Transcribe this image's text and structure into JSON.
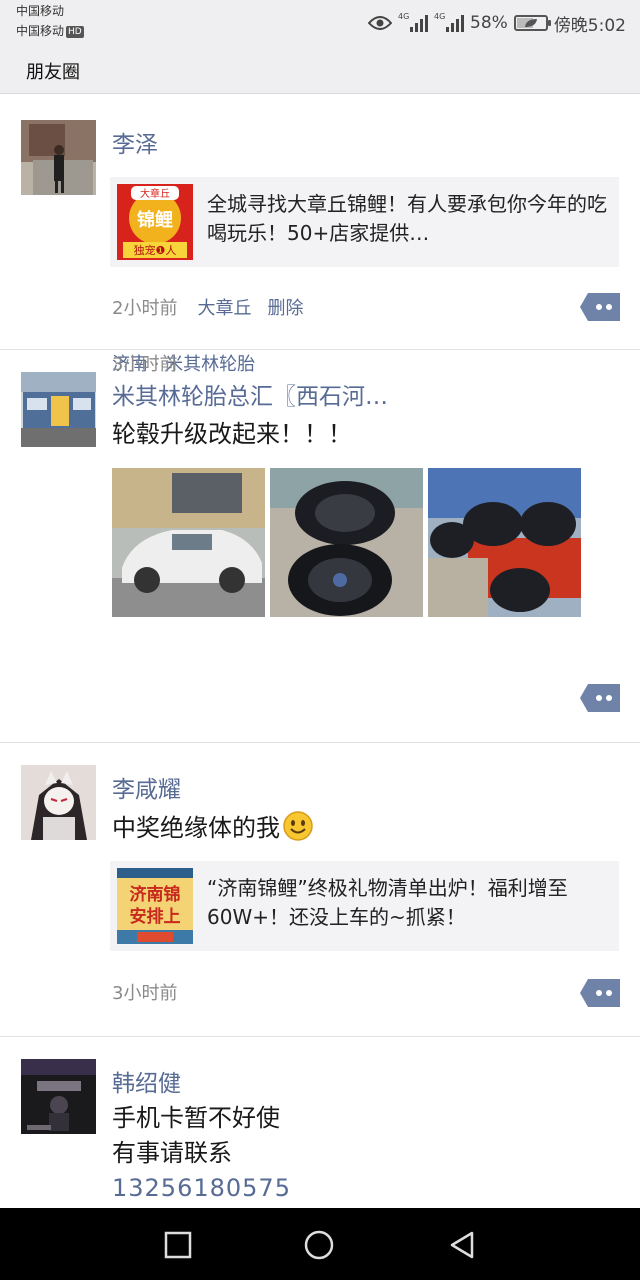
{
  "status_bar": {
    "carrier_1": "中国移动",
    "carrier_2": "中国移动",
    "hd_badge": "HD",
    "network_1": "4G",
    "network_2": "4G",
    "battery_percent": "58%",
    "battery_level": 0.58,
    "time": "傍晚5:02"
  },
  "header": {
    "title": "朋友圈"
  },
  "posts": [
    {
      "name": "李泽",
      "link_card": {
        "thumb_text": [
          "大章丘",
          "锦鲤",
          "独宠❶人"
        ],
        "title": "全城寻找大章丘锦鲤！有人要承包你今年的吃喝玩乐！50+店家提供…"
      },
      "time": "2小时前",
      "location": "大章丘",
      "delete_label": "删除"
    },
    {
      "name": "米其林轮胎总汇〖西石河…",
      "text": "轮毂升级改起来！！！",
      "location": "济南 · 米其林轮胎",
      "time": "3小时前"
    },
    {
      "name": "李咸耀",
      "text": "中奖绝缘体的我",
      "link_card": {
        "thumb_text": [
          "济南锦",
          "安排上"
        ],
        "title": "“济南锦鲤”终极礼物清单出炉！福利增至60W+！还没上车的~抓紧！"
      },
      "time": "3小时前"
    },
    {
      "name": "韩绍健",
      "text_lines": [
        "手机卡暂不好使",
        "有事请联系"
      ],
      "phone": "13256180575"
    }
  ],
  "colors": {
    "link_blue": "#576b95",
    "header_bg": "#efeff1",
    "card_bg": "#f3f3f5",
    "nav_bg": "#000000"
  }
}
